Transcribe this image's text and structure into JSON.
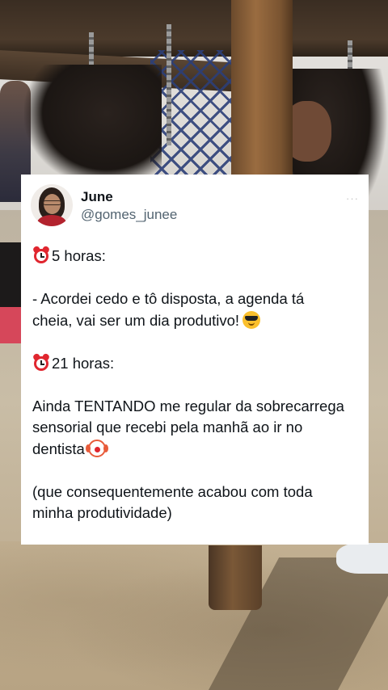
{
  "tweet": {
    "author_name": "June",
    "author_handle": "@gomes_junee",
    "more_label": "···",
    "lines": {
      "l1": "5 horas:",
      "l2": "- Acordei cedo e tô disposta, a agenda tá",
      "l3": "cheia, vai ser um dia produtivo!",
      "l4": "21 horas:",
      "l5": "Ainda TENTANDO me regular da sobrecarrega",
      "l6": "sensorial que recebi pela manhã ao ir no",
      "l7": "dentista",
      "l8": "(que consequentemente acabou com toda",
      "l9": "minha produtividade)"
    },
    "emojis": [
      "alarm-clock",
      "smiling-face-with-sunglasses",
      "alarm-clock",
      "clown-face"
    ]
  },
  "colors": {
    "card_bg": "#ffffff",
    "text": "#0f1419",
    "handle": "#536471"
  }
}
